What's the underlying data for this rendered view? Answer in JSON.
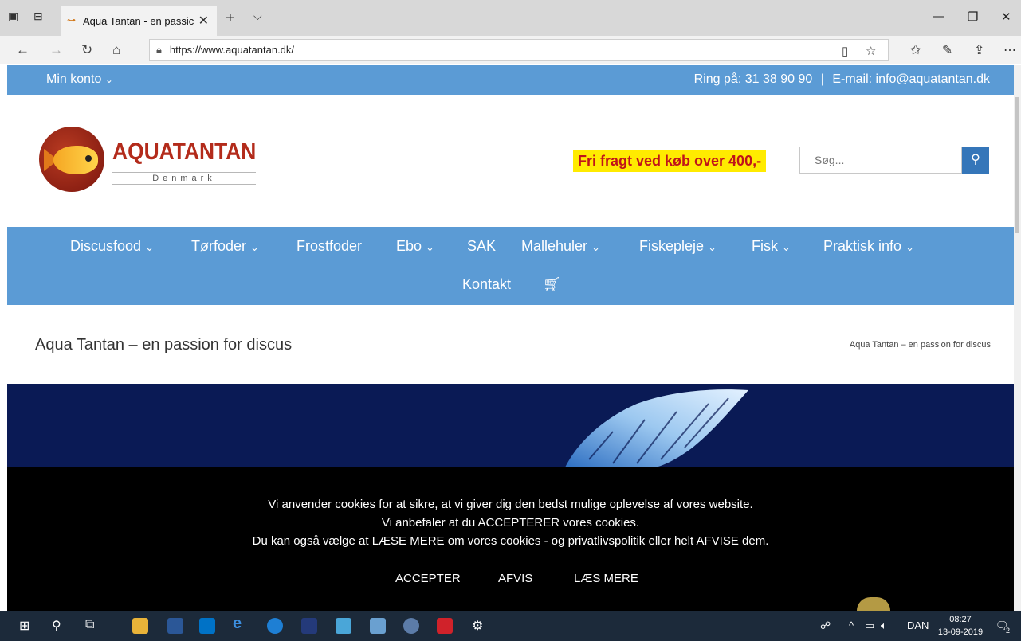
{
  "browser": {
    "tab_title": "Aqua Tantan - en passic",
    "url": "https://www.aquatantan.dk/"
  },
  "topbar": {
    "account_label": "Min konto",
    "phone_prefix": "Ring på:",
    "phone": "31 38 90 90",
    "separator": "|",
    "email": "E-mail: info@aquatantan.dk"
  },
  "header": {
    "logo_text": "AQUATANTAN",
    "logo_sub": "Denmark",
    "promo": "Fri fragt ved køb over 400,-",
    "search_placeholder": "Søg..."
  },
  "nav": {
    "items": [
      {
        "label": "Discusfood",
        "dropdown": true
      },
      {
        "label": "Tørfoder",
        "dropdown": true
      },
      {
        "label": "Frostfoder",
        "dropdown": false
      },
      {
        "label": "Ebo",
        "dropdown": true
      },
      {
        "label": "SAK",
        "dropdown": false
      },
      {
        "label": "Mallehuler",
        "dropdown": true
      },
      {
        "label": "Fiskepleje",
        "dropdown": true
      },
      {
        "label": "Fisk",
        "dropdown": true
      },
      {
        "label": "Praktisk info",
        "dropdown": true
      }
    ],
    "contact": "Kontakt"
  },
  "page": {
    "title": "Aqua Tantan – en passion for discus",
    "breadcrumb": "Aqua Tantan – en passion for discus"
  },
  "cookie": {
    "line1": "Vi anvender cookies for at sikre, at vi giver dig den bedst mulige oplevelse af vores website.",
    "line2": "Vi anbefaler at du ACCEPTERER vores cookies.",
    "line3": "Du kan også vælge at LÆSE MERE om vores cookies - og privatlivspolitik eller helt AFVISE dem.",
    "accept": "ACCEPTER",
    "reject": "AFVIS",
    "read_more": "LÆS MERE"
  },
  "taskbar": {
    "language": "DAN",
    "time": "08:27",
    "date": "13-09-2019",
    "notification_count": "2"
  },
  "colors": {
    "nav_blue": "#5b9bd5",
    "promo_yellow": "#ffeb00",
    "promo_red": "#c0131a",
    "search_button": "#3576b9",
    "cookie_bg": "#000000"
  }
}
